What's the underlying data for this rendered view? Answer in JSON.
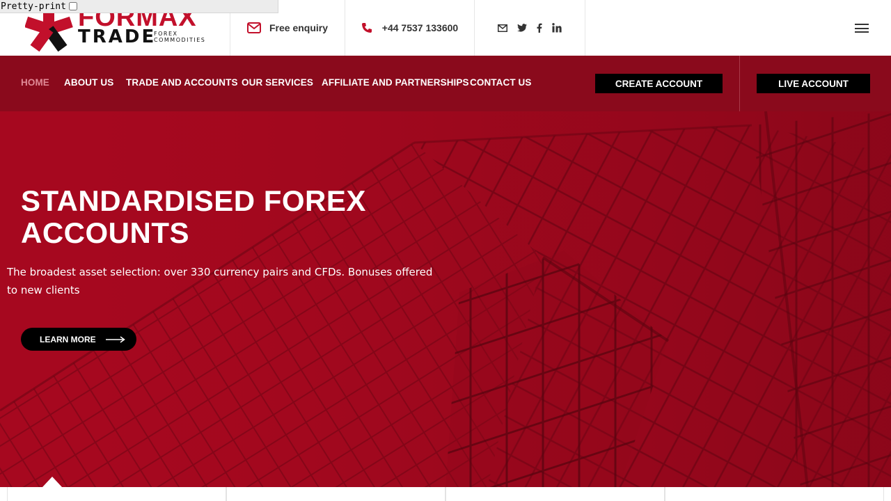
{
  "pretty_print": {
    "label": "Pretty-print",
    "checked": false
  },
  "logo": {
    "name": "FORMAX",
    "trade": "TRADE",
    "sub_line1": "FOREX",
    "sub_line2": "COMMODITIES",
    "brand_color": "#c2102b"
  },
  "header": {
    "enquiry_label": "Free enquiry",
    "phone": "+44 7537 133600",
    "social": [
      "email-icon",
      "twitter-icon",
      "facebook-icon",
      "linkedin-icon"
    ]
  },
  "nav": {
    "items": [
      {
        "label": "HOME",
        "active": true
      },
      {
        "label": "ABOUT US"
      },
      {
        "label": "TRADE AND ACCOUNTS"
      },
      {
        "label": "OUR SERVICES"
      },
      {
        "label": "AFFILIATE AND PARTNERSHIPS"
      },
      {
        "label": "CONTACT US"
      }
    ],
    "create_account": "CREATE ACCOUNT",
    "live_account": "LIVE ACCOUNT"
  },
  "hero": {
    "title": "STANDARDISED FOREX ACCOUNTS",
    "description": "The broadest asset selection: over 330 currency pairs and CFDs. Bonuses offered to new clients",
    "button": "LEARN MORE"
  },
  "colors": {
    "nav_bg": "#8a0a1c",
    "hero_bg": "#a6081f",
    "button_bg": "#000000"
  }
}
